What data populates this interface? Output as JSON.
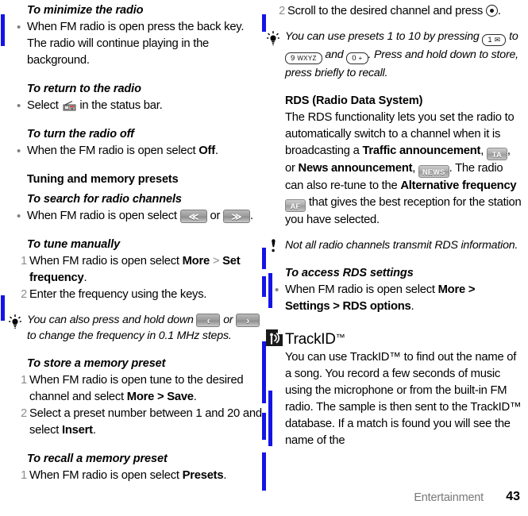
{
  "page": {
    "footer_section": "Entertainment",
    "footer_page_number": "43",
    "change_bar_color": "#1414e6"
  },
  "left_column": {
    "blocks": [
      {
        "type": "task_heading",
        "text": "To minimize the radio"
      },
      {
        "type": "bullet",
        "text": "When FM radio is open press the back key. The radio will continue playing in the background."
      },
      {
        "type": "task_heading",
        "text": "To return to the radio"
      },
      {
        "type": "bullet_icon",
        "text_before": "Select ",
        "icon": "fm-radio-status-icon",
        "text_after": " in the status bar."
      },
      {
        "type": "task_heading",
        "text": "To turn the radio off"
      },
      {
        "type": "bullet",
        "text_before": "When the FM radio is open select ",
        "bold": "Off",
        "text_after": "."
      },
      {
        "type": "section_heading",
        "text": "Tuning and memory presets"
      },
      {
        "type": "task_heading",
        "text": "To search for radio channels"
      },
      {
        "type": "bullet_keys",
        "text_before": "When FM radio is open select ",
        "key1": "≪",
        "text_mid": " or ",
        "key2": "≫",
        "text_after": "."
      },
      {
        "type": "task_heading",
        "text": "To tune manually"
      },
      {
        "type": "step",
        "number": "1",
        "text_before": "When FM radio is open select ",
        "bold1": "More",
        "sep": " > ",
        "bold2": "Set frequency",
        "text_after": "."
      },
      {
        "type": "step",
        "number": "2",
        "text": "Enter the frequency using the keys."
      },
      {
        "type": "tip",
        "icon": "lightbulb-tip-icon",
        "text_before": "You can also press and hold down ",
        "key1": "‹",
        "text_mid": " or ",
        "key2": "›",
        "text_after": " to change the frequency in 0.1 MHz steps."
      },
      {
        "type": "task_heading",
        "text": "To store a memory preset"
      },
      {
        "type": "step",
        "number": "1",
        "text_before": "When FM radio is open tune to the desired channel and select ",
        "bold1": "More > Save",
        "text_after": "."
      },
      {
        "type": "step",
        "number": "2",
        "text_before": "Select a preset number between 1 and 20 and select ",
        "bold1": "Insert",
        "text_after": "."
      },
      {
        "type": "task_heading",
        "text": "To recall a memory preset"
      },
      {
        "type": "step",
        "number": "1",
        "text_before": "When FM radio is open select ",
        "bold1": "Presets",
        "text_after": "."
      }
    ]
  },
  "right_column": {
    "blocks": [
      {
        "type": "step",
        "number": "2",
        "text_before": "Scroll to the desired channel and press ",
        "icon": "nav-select-key-icon",
        "text_after": "."
      },
      {
        "type": "tip",
        "icon": "lightbulb-tip-icon",
        "text_before": "You can use presets 1 to 10 by pressing ",
        "key1_digit": "1",
        "key1_sub": "✉",
        "text_mid1": " to ",
        "key2_digit": "9",
        "key2_sub": "WXYZ",
        "text_mid2": " and ",
        "key3_digit": "0",
        "key3_sub": "+",
        "text_after": ". Press and hold down to store, press briefly to recall."
      },
      {
        "type": "section_heading",
        "text": "RDS (Radio Data System)"
      },
      {
        "type": "paragraph_rds",
        "t1": "The RDS functionality lets you set the radio to automatically switch to a channel when it is broadcasting a ",
        "b1": "Traffic announcement",
        "t2": ", ",
        "badge1": "TA",
        "t3": ", or ",
        "b2": "News announcement",
        "t4": ", ",
        "badge2": "NEWS",
        "t5": ". The radio can also re-tune to the ",
        "b3": "Alternative frequency",
        "t6": " ",
        "badge3": "AF",
        "t7": " that gives the best reception for the station you have selected."
      },
      {
        "type": "note",
        "icon": "exclamation-note-icon",
        "text": "Not all radio channels transmit RDS information."
      },
      {
        "type": "task_heading",
        "text": "To access RDS settings"
      },
      {
        "type": "bullet",
        "text_before": "When FM radio is open select ",
        "bold": "More > Settings > RDS options",
        "text_after": "."
      },
      {
        "type": "app_heading",
        "icon": "trackid-app-icon",
        "text": "TrackID",
        "trademark": "™"
      },
      {
        "type": "paragraph",
        "text": "You can use TrackID™ to find out the name of a song. You record a few seconds of music using the microphone or from the built-in FM radio. The sample is then sent to the TrackID™ database. If a match is found you will see the name of the"
      }
    ]
  }
}
